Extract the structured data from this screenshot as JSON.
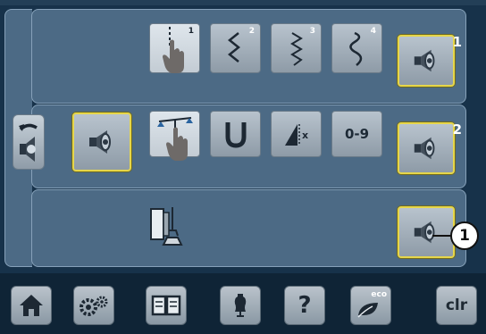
{
  "stitch_row": {
    "buttons": [
      {
        "id": "straight",
        "superscript": "1"
      },
      {
        "id": "zigzag-2",
        "superscript": "2"
      },
      {
        "id": "zigzag-3",
        "superscript": "3"
      },
      {
        "id": "zigzag-4",
        "superscript": "4"
      }
    ],
    "sound_superscript": "1"
  },
  "function_row": {
    "digits_label": "0-9",
    "sound_superscript": "2"
  },
  "callout": {
    "number": "1"
  },
  "taskbar": {
    "eco_label": "eco",
    "help_label": "?",
    "clear_label": "clr"
  },
  "colors": {
    "panel": "#4c6a85",
    "selected_border": "#e6d64a",
    "background": "#17324a"
  }
}
